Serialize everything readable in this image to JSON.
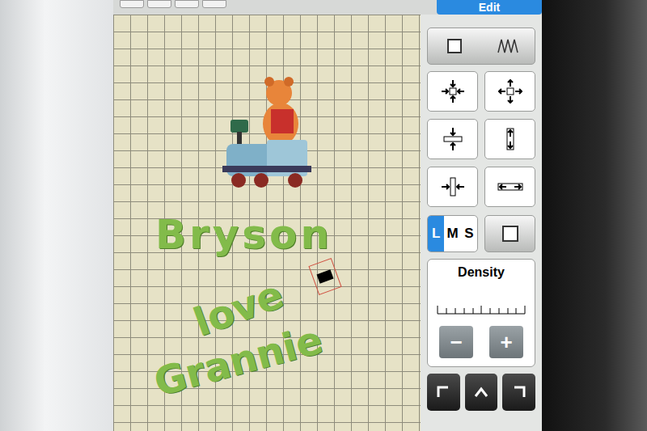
{
  "header": {
    "edit_button": "Edit"
  },
  "design": {
    "texts": [
      {
        "text": "Bryson"
      },
      {
        "text": "love"
      },
      {
        "text": "Grannie"
      }
    ]
  },
  "sizes": [
    {
      "label": "L",
      "selected": true
    },
    {
      "label": "M",
      "selected": false
    },
    {
      "label": "S",
      "selected": false
    }
  ],
  "density": {
    "label": "Density",
    "minus": "−",
    "plus": "+"
  }
}
